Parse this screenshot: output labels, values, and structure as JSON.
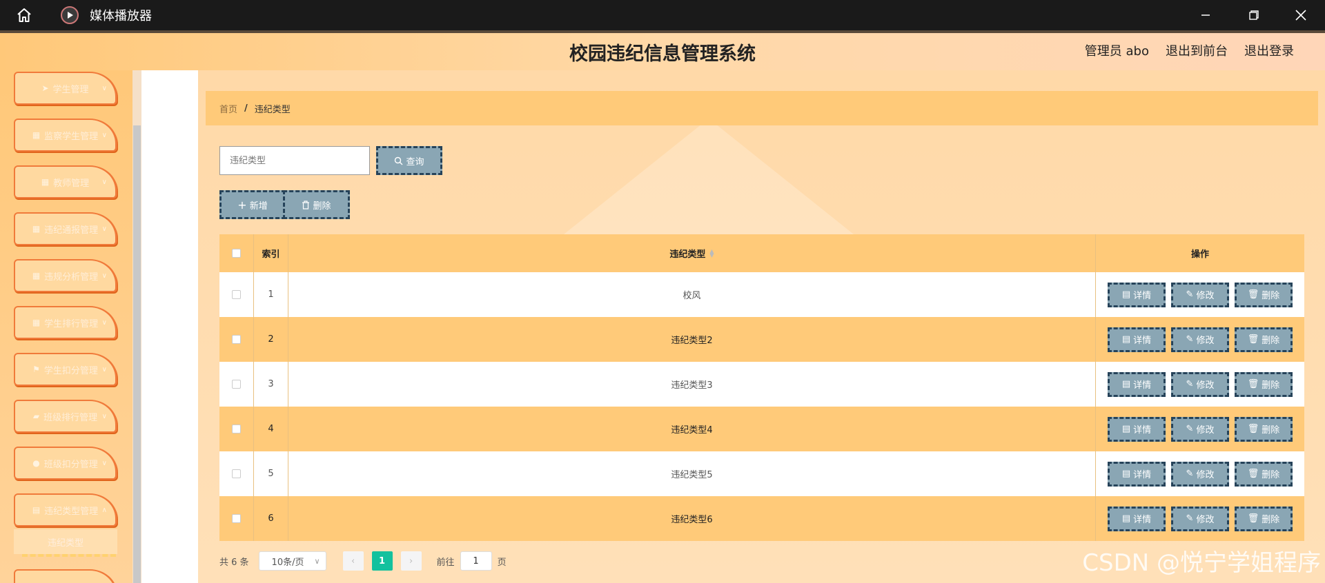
{
  "titlebar": {
    "app_title": "媒体播放器"
  },
  "header": {
    "system_title": "校园违纪信息管理系统",
    "nav": [
      "管理员 abo",
      "退出到前台",
      "退出登录"
    ]
  },
  "sidebar": {
    "items": [
      {
        "label": "学生管理",
        "icon": "send-icon"
      },
      {
        "label": "监察学生管理",
        "icon": "grid-icon"
      },
      {
        "label": "教师管理",
        "icon": "grid-icon"
      },
      {
        "label": "违纪通报管理",
        "icon": "grid-icon"
      },
      {
        "label": "违规分析管理",
        "icon": "grid-icon"
      },
      {
        "label": "学生排行管理",
        "icon": "grid-icon"
      },
      {
        "label": "学生扣分管理",
        "icon": "flag-icon"
      },
      {
        "label": "班级排行管理",
        "icon": "thumb-icon"
      },
      {
        "label": "班级扣分管理",
        "icon": "pin-icon"
      },
      {
        "label": "违纪类型管理",
        "icon": "clipboard-icon"
      }
    ],
    "active_sub": "违纪类型"
  },
  "breadcrumb": {
    "home": "首页",
    "separator": "/",
    "current": "违纪类型"
  },
  "search": {
    "placeholder": "违纪类型",
    "button": "查询"
  },
  "actions": {
    "add": "新增",
    "delete": "删除"
  },
  "table": {
    "headers": {
      "index": "索引",
      "type": "违纪类型",
      "ops": "操作"
    },
    "rows": [
      {
        "index": "1",
        "type": "校风"
      },
      {
        "index": "2",
        "type": "违纪类型2"
      },
      {
        "index": "3",
        "type": "违纪类型3"
      },
      {
        "index": "4",
        "type": "违纪类型4"
      },
      {
        "index": "5",
        "type": "违纪类型5"
      },
      {
        "index": "6",
        "type": "违纪类型6"
      }
    ],
    "row_actions": {
      "detail": "详情",
      "edit": "修改",
      "delete": "删除"
    }
  },
  "pagination": {
    "total": "共 6 条",
    "page_size": "10条/页",
    "current_page": "1",
    "goto_prefix": "前往",
    "goto_value": "1",
    "goto_suffix": "页"
  },
  "watermark": "CSDN @悦宁学姐程序"
}
